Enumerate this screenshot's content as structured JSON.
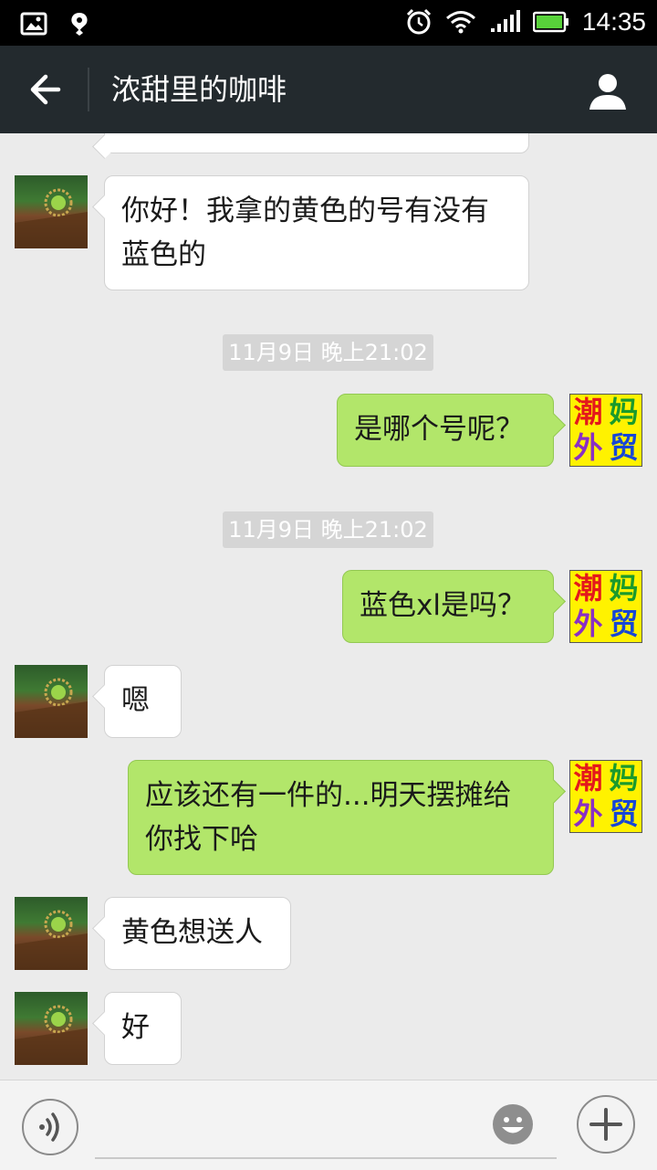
{
  "status_bar": {
    "time": "14:35",
    "icons": [
      "image-icon",
      "notification-icon",
      "alarm-icon",
      "wifi-icon",
      "signal-icon",
      "battery-icon"
    ]
  },
  "app_bar": {
    "title": "浓甜里的咖啡",
    "icons": [
      "back-arrow-icon",
      "profile-icon"
    ]
  },
  "messages": [
    {
      "side": "left",
      "text_line1": "你好！我拿的黄色的号有没有",
      "text_line2": "蓝色的"
    },
    {
      "timestamp": "11月9日 晚上21:02"
    },
    {
      "side": "right",
      "text": "是哪个号呢？"
    },
    {
      "timestamp": "11月9日 晚上21:02"
    },
    {
      "side": "right",
      "text": "蓝色xl是吗？"
    },
    {
      "side": "left",
      "text": "嗯"
    },
    {
      "side": "right",
      "text_line1": "应该还有一件的...明天摆摊给",
      "text_line2": "你找下哈"
    },
    {
      "side": "left",
      "text": "黄色想送人"
    },
    {
      "side": "left",
      "text": "好"
    }
  ],
  "self_avatar": {
    "chars": [
      "潮",
      "妈",
      "外",
      "贸"
    ],
    "colors": [
      "#e4181c",
      "#1a9a2c",
      "#8a2fc4",
      "#1746d6"
    ]
  },
  "input_bar": {
    "icons": [
      "voice-icon",
      "emoji-icon",
      "plus-icon"
    ],
    "text_value": ""
  },
  "colors": {
    "outgoing_bubble": "#b2e66a",
    "incoming_bubble": "#ffffff",
    "app_bar": "#232a2e",
    "background": "#ebebeb"
  }
}
